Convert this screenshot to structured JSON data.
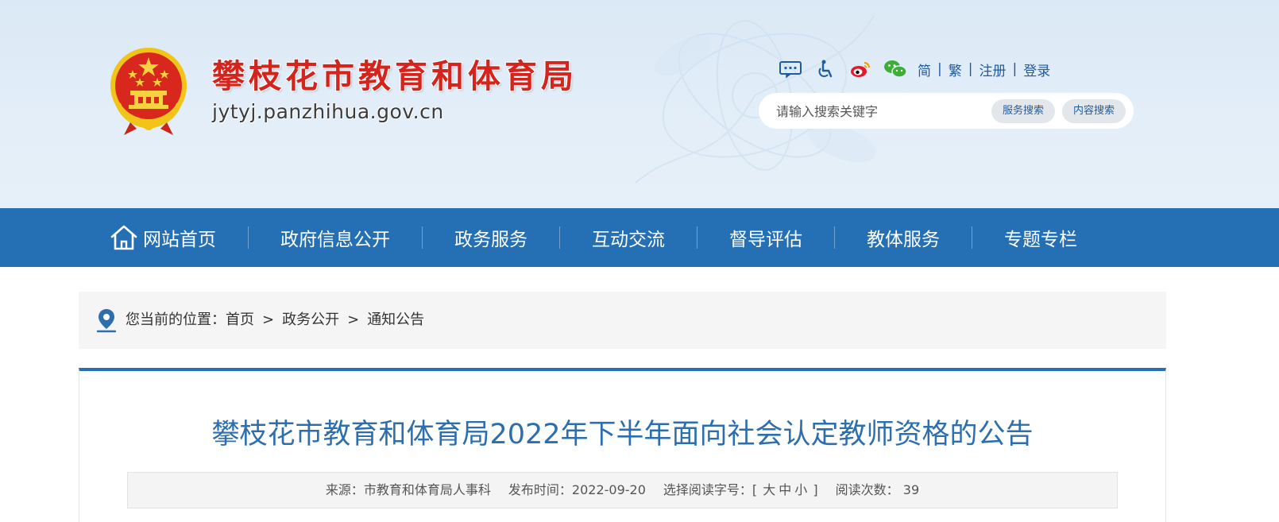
{
  "header": {
    "site_name": "攀枝花市教育和体育局",
    "domain": "jytyj.panzhihua.gov.cn",
    "toolbar": {
      "icons": [
        "message-icon",
        "accessibility-icon",
        "weibo-icon",
        "wechat-icon"
      ],
      "simplified": "简",
      "traditional": "繁",
      "register": "注册",
      "login": "登录",
      "separator": "|"
    },
    "search": {
      "placeholder": "请输入搜索关键字",
      "service_button": "服务搜索",
      "content_button": "内容搜索"
    }
  },
  "nav": {
    "items": [
      {
        "label": "网站首页"
      },
      {
        "label": "政府信息公开"
      },
      {
        "label": "政务服务"
      },
      {
        "label": "互动交流"
      },
      {
        "label": "督导评估"
      },
      {
        "label": "教体服务"
      },
      {
        "label": "专题专栏"
      }
    ]
  },
  "breadcrumb": {
    "prefix": "您当前的位置：",
    "items": [
      "首页",
      "政务公开",
      "通知公告"
    ],
    "separator": ">"
  },
  "article": {
    "title": "攀枝花市教育和体育局2022年下半年面向社会认定教师资格的公告",
    "meta": {
      "source_label": "来源：",
      "source": "市教育和体育局人事科",
      "date_label": "发布时间：",
      "date": "2022-09-20",
      "font_label": "选择阅读字号：",
      "bracket_open": "[",
      "font_large": "大",
      "font_medium": "中",
      "font_small": "小",
      "bracket_close": "]",
      "views_label": "阅读次数：",
      "views": "39"
    }
  },
  "colors": {
    "nav_blue": "#2570b5",
    "title_blue": "#2d6fae",
    "brand_red": "#d3251d",
    "header_bg": "#dde9f6"
  }
}
